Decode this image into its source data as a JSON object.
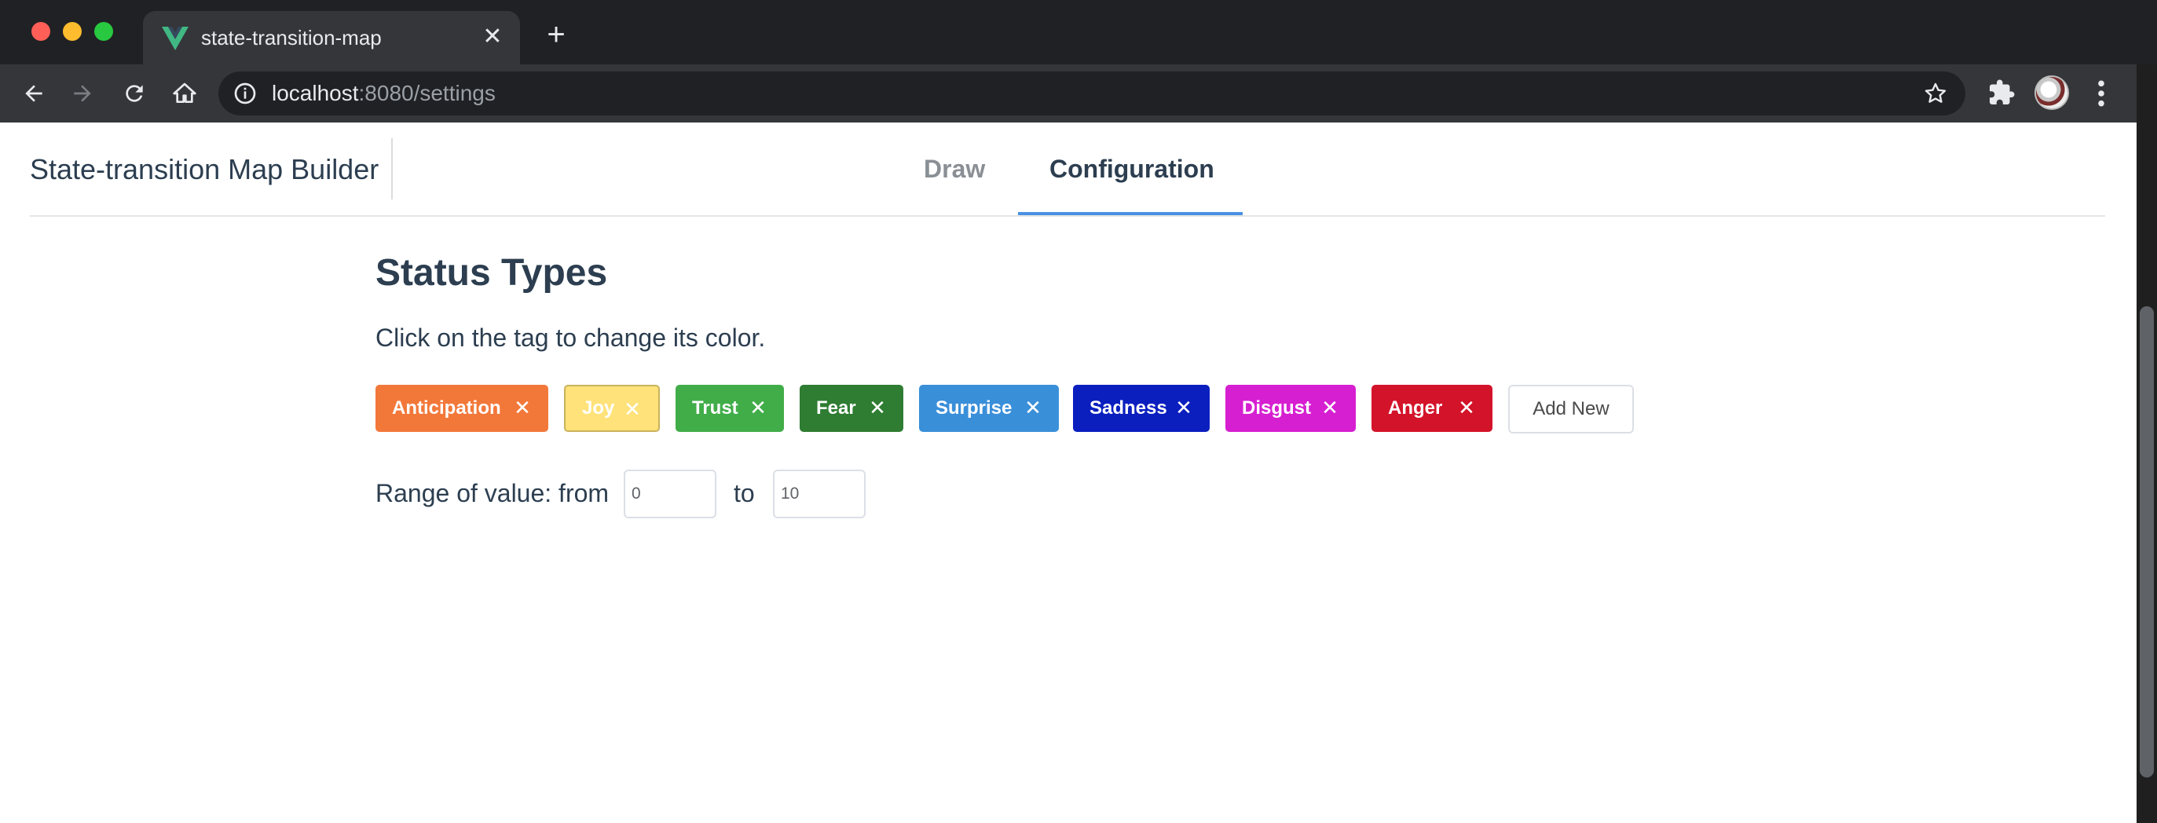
{
  "browser": {
    "tab_title": "state-transition-map",
    "new_tab_label": "+",
    "close_tab_label": "✕",
    "url_host": "localhost",
    "url_rest": ":8080/settings"
  },
  "app": {
    "brand": "State-transition Map Builder",
    "nav": {
      "draw": "Draw",
      "configuration": "Configuration",
      "active": "configuration"
    }
  },
  "status_types": {
    "title": "Status Types",
    "hint": "Click on the tag to change its color.",
    "tags": [
      {
        "label": "Anticipation",
        "color": "#f2783a"
      },
      {
        "label": "Joy",
        "color": "#ffe27a",
        "text_color": "#ffffff"
      },
      {
        "label": "Trust",
        "color": "#41ad49"
      },
      {
        "label": "Fear",
        "color": "#2e7d32"
      },
      {
        "label": "Surprise",
        "color": "#3a8fd9"
      },
      {
        "label": "Sadness",
        "color": "#0b1fbf"
      },
      {
        "label": "Disgust",
        "color": "#d61fd1"
      },
      {
        "label": "Anger",
        "color": "#d3132a"
      }
    ],
    "remove_symbol": "✕",
    "add_new_label": "Add New"
  },
  "range": {
    "label": "Range of value: from",
    "to_label": "to",
    "from_value": "0",
    "to_value": "10"
  }
}
